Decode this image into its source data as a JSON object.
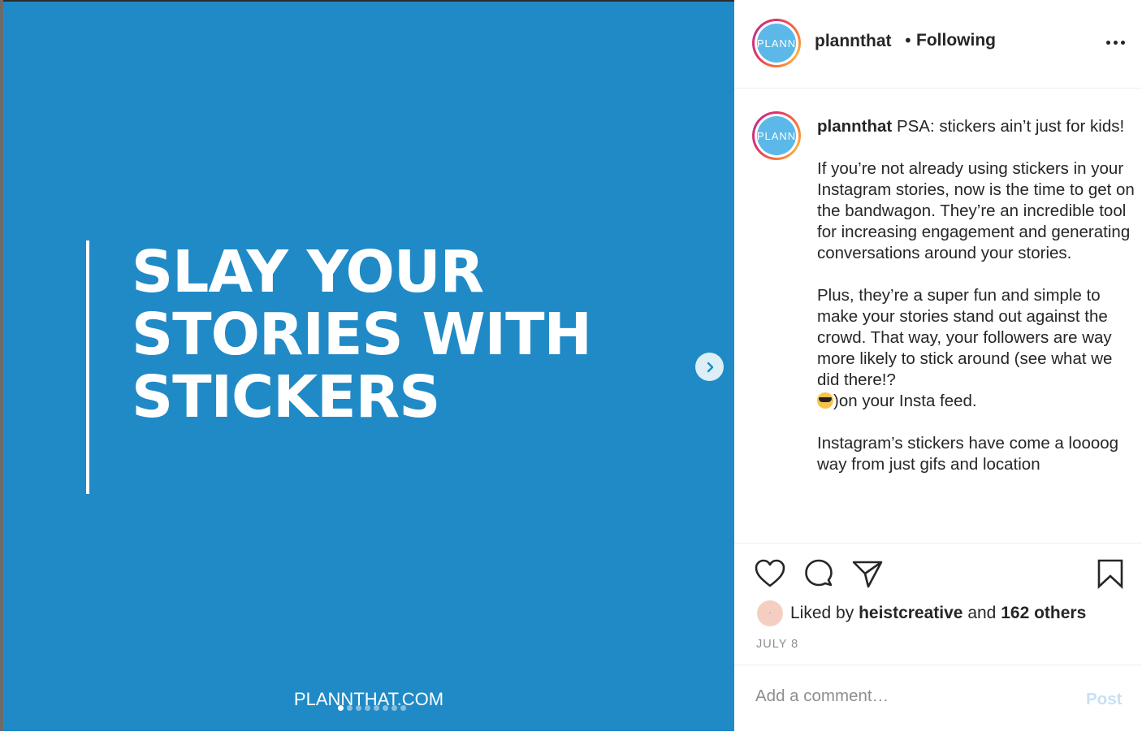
{
  "slide": {
    "headline_lines": [
      "SLAY YOUR",
      "STORIES WITH",
      "STICKERS"
    ],
    "footer_url": "PLANNTHAT.COM",
    "background_color": "#208ac6",
    "next_icon": "chevron-right-icon"
  },
  "header": {
    "avatar_text": "PLANN",
    "username": "plannthat",
    "separator": "•",
    "follow_status": "Following",
    "more_icon": "more-options-icon"
  },
  "caption": {
    "avatar_text": "PLANN",
    "username": "plannthat",
    "intro": " PSA: stickers ain’t just for kids!",
    "paragraph_1": "If you’re not already using stickers in your Instagram stories, now is the time to get on the bandwagon. They’re an incredible tool for increasing engagement and generating conversations around your stories.",
    "paragraph_2_a": "Plus, they’re a super fun and simple to make your stories stand out against the crowd. That way, your followers are way more likely to stick around (see what we did there!?",
    "paragraph_2_b": ")on your Insta feed.",
    "paragraph_3": "Instagram’s stickers have come a loooog way from just gifs and location"
  },
  "actions": {
    "like_icon": "heart-icon",
    "comment_icon": "comment-icon",
    "share_icon": "paper-plane-icon",
    "save_icon": "bookmark-icon",
    "liked_by_prefix": "Liked by ",
    "liked_by_user": "heistcreative",
    "liked_by_and": " and ",
    "liked_by_others": "162 others",
    "date": "JULY 8"
  },
  "comment": {
    "placeholder": "Add a comment…",
    "post_label": "Post"
  }
}
